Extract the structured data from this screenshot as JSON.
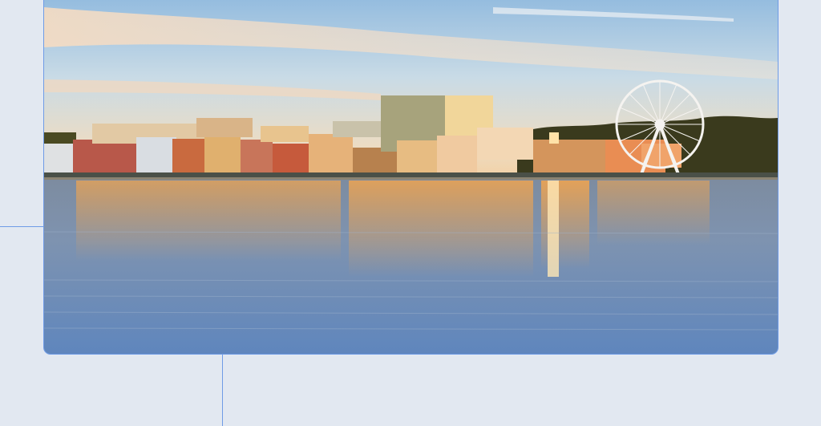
{
  "hero_image": {
    "subject": "waterfront-skyline-sunset-photo",
    "colors": {
      "sky_top": "#8fb9de",
      "sky_mid": "#d7e1e4",
      "horizon_glow": "#f4d0a1",
      "water": "#6f8fb6",
      "reflection": "#f2a44a",
      "guide_line": "#6f9be6",
      "page_background": "#e2e8f1"
    },
    "icons": [
      "ferris-wheel-icon"
    ]
  }
}
